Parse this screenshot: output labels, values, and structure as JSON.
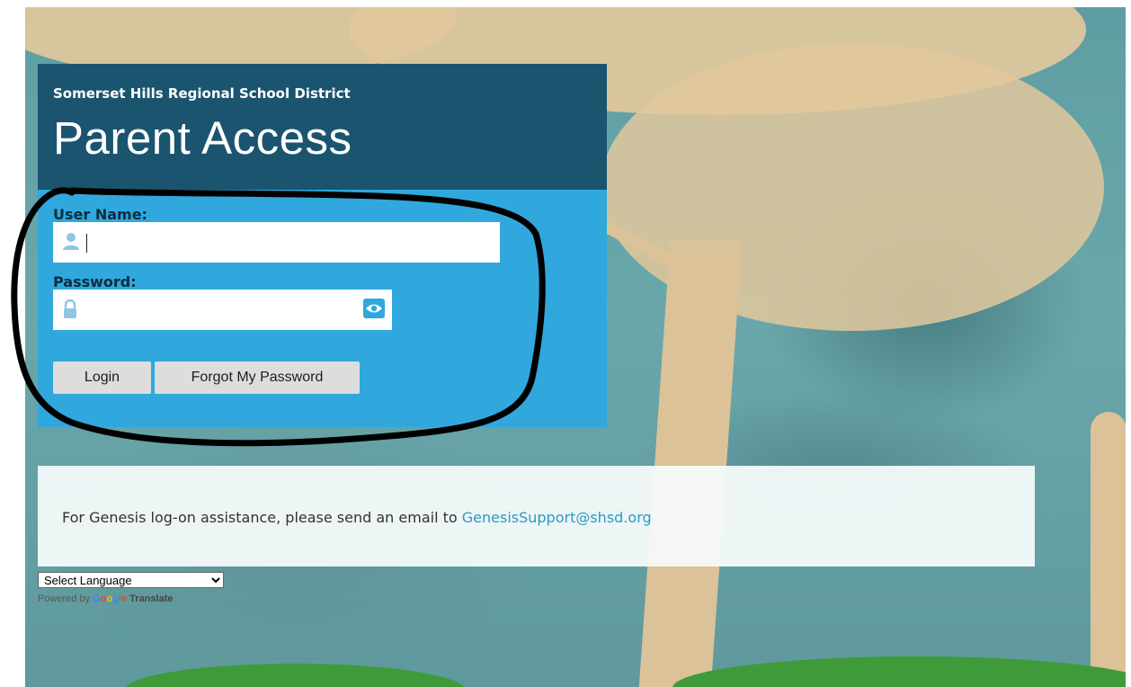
{
  "header": {
    "district": "Somerset Hills Regional School District",
    "title": "Parent Access"
  },
  "form": {
    "username_label": "User Name:",
    "username_value": "",
    "password_label": "Password:",
    "password_value": "",
    "login_label": "Login",
    "forgot_label": "Forgot My Password"
  },
  "info": {
    "text": "For Genesis log-on assistance, please send an email to ",
    "link": "GenesisSupport@shsd.org"
  },
  "translate": {
    "select_value": "Select Language",
    "powered_by": "Powered by ",
    "google": "Google",
    "translate": "Translate"
  },
  "colors": {
    "header_bg": "#1b546f",
    "form_bg": "#30a8dd",
    "link": "#2a9ac4"
  },
  "icons": [
    "user-icon",
    "lock-icon",
    "eye-icon",
    "chevron-down-icon"
  ]
}
